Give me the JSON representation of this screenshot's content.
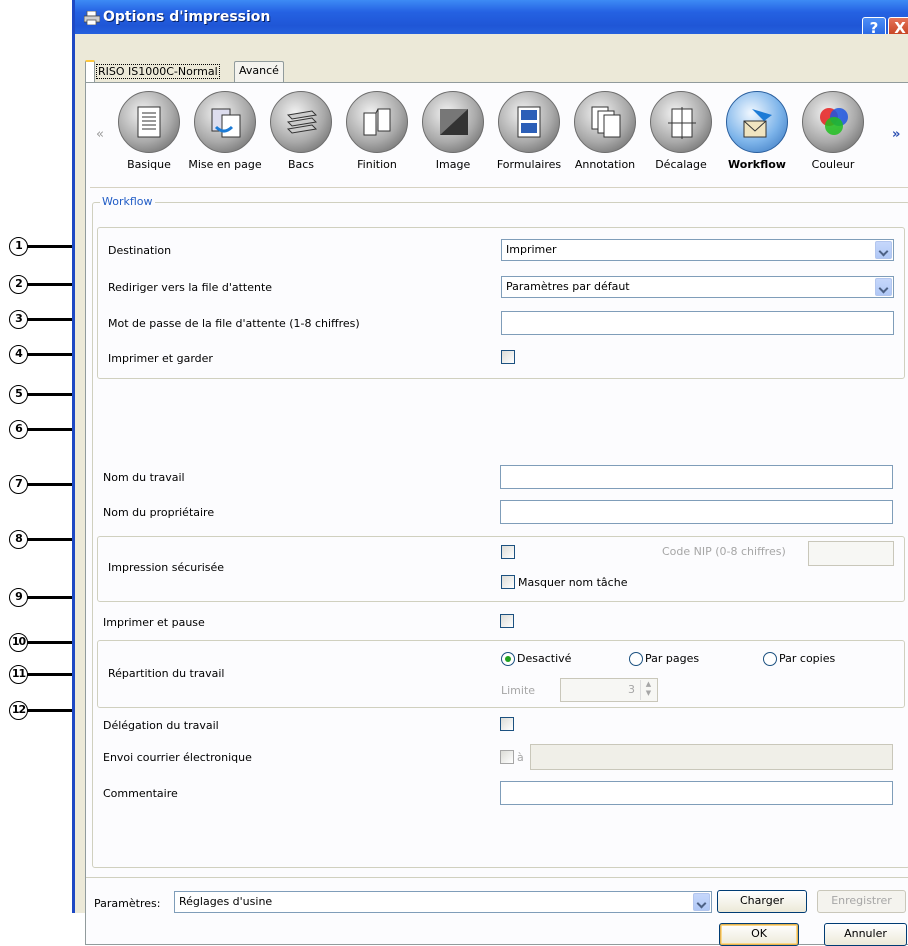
{
  "window": {
    "title": "Options d'impression",
    "help_button": "?",
    "close_button": "X"
  },
  "tabs": [
    {
      "label": "RISO IS1000C-Normal",
      "active": true
    },
    {
      "label": "Avancé",
      "active": false
    }
  ],
  "icon_bar": {
    "left_arrow": "«",
    "right_arrow": "»",
    "items": [
      {
        "label": "Basique",
        "icon": "document-icon"
      },
      {
        "label": "Mise en page",
        "icon": "layout-icon"
      },
      {
        "label": "Bacs",
        "icon": "tray-icon"
      },
      {
        "label": "Finition",
        "icon": "finishing-icon"
      },
      {
        "label": "Image",
        "icon": "image-icon"
      },
      {
        "label": "Formulaires",
        "icon": "forms-icon"
      },
      {
        "label": "Annotation",
        "icon": "annotation-icon"
      },
      {
        "label": "Décalage",
        "icon": "shift-icon"
      },
      {
        "label": "Workflow",
        "icon": "workflow-icon",
        "selected": true
      },
      {
        "label": "Couleur",
        "icon": "color-icon"
      }
    ]
  },
  "workflow": {
    "group_title": "Workflow",
    "destination": {
      "label": "Destination",
      "value": "Imprimer"
    },
    "redirect_queue": {
      "label": "Rediriger vers la file d'attente",
      "value": "Paramètres par défaut"
    },
    "queue_password": {
      "label": "Mot de passe de la file d'attente (1-8 chiffres)",
      "value": ""
    },
    "print_and_keep": {
      "label": "Imprimer et garder",
      "checked": false
    },
    "job_name": {
      "label": "Nom du travail",
      "value": ""
    },
    "owner_name": {
      "label": "Nom du propriétaire",
      "value": ""
    },
    "secure_print": {
      "label": "Impression sécurisée",
      "checked": false,
      "pin_label": "Code NIP (0-8 chiffres)",
      "pin_value": "",
      "hide_job_name_label": "Masquer nom tâche",
      "hide_job_name_checked": false
    },
    "print_and_pause": {
      "label": "Imprimer et pause",
      "checked": false
    },
    "job_split": {
      "label": "Répartition du travail",
      "options": [
        "Desactivé",
        "Par pages",
        "Par copies"
      ],
      "selected": "Desactivé",
      "limit_label": "Limite",
      "limit_value": "3"
    },
    "job_delegation": {
      "label": "Délégation du travail",
      "checked": false
    },
    "email": {
      "label": "Envoi courrier électronique",
      "checked": false,
      "to_label": "à",
      "value": ""
    },
    "comment": {
      "label": "Commentaire",
      "value": ""
    }
  },
  "footer": {
    "settings_label": "Paramètres:",
    "settings_value": "Réglages d'usine",
    "load_button": "Charger",
    "save_button": "Enregistrer",
    "ok_button": "OK",
    "cancel_button": "Annuler"
  },
  "callouts": [
    "1",
    "2",
    "3",
    "4",
    "5",
    "6",
    "7",
    "8",
    "9",
    "10",
    "11",
    "12"
  ],
  "colors": {
    "titlebar_blue": "#2562e3",
    "panel_bg": "#ece9d8",
    "group_title_blue": "#215dc6",
    "radio_green": "#21a121"
  }
}
